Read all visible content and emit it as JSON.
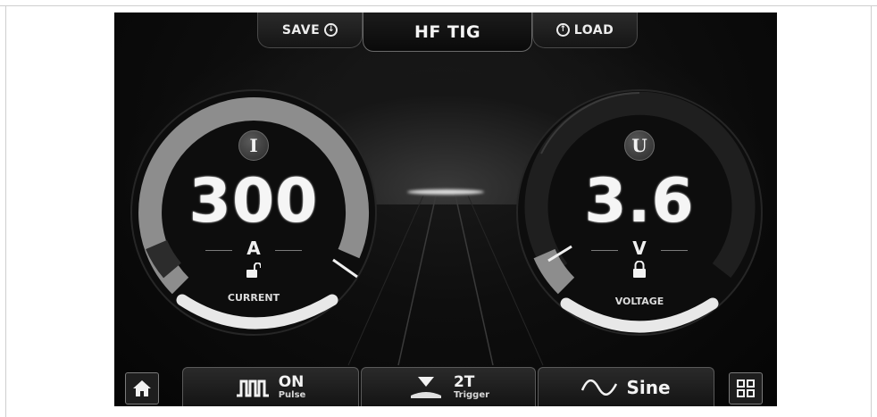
{
  "header": {
    "save_label": "SAVE",
    "mode_title": "HF TIG",
    "load_label": "LOAD",
    "save_icon": "download-circle-icon",
    "load_icon": "upload-circle-icon"
  },
  "current_gauge": {
    "symbol": "I",
    "value": "300",
    "unit": "A",
    "label": "CURRENT",
    "lock_state": "unlocked",
    "level_fraction": 1.0
  },
  "voltage_gauge": {
    "symbol": "U",
    "value": "3.6",
    "unit": "V",
    "label": "VOLTAGE",
    "lock_state": "locked",
    "level_fraction": 0.08
  },
  "footer": {
    "home_icon": "home-icon",
    "pulse": {
      "state": "ON",
      "label": "Pulse",
      "icon": "pulse-wave-icon"
    },
    "trigger": {
      "mode": "2T",
      "label": "Trigger",
      "icon": "trigger-icon"
    },
    "waveform": {
      "label": "Sine",
      "icon": "sine-wave-icon"
    },
    "menu_icon": "grid-menu-icon"
  },
  "colors": {
    "screen_bg": "#0a0a0a",
    "text": "#f5f5f5",
    "arc_fill": "#9a9a9a",
    "arc_track": "#2a2a2a",
    "label_arc": "#e8e8e8"
  }
}
